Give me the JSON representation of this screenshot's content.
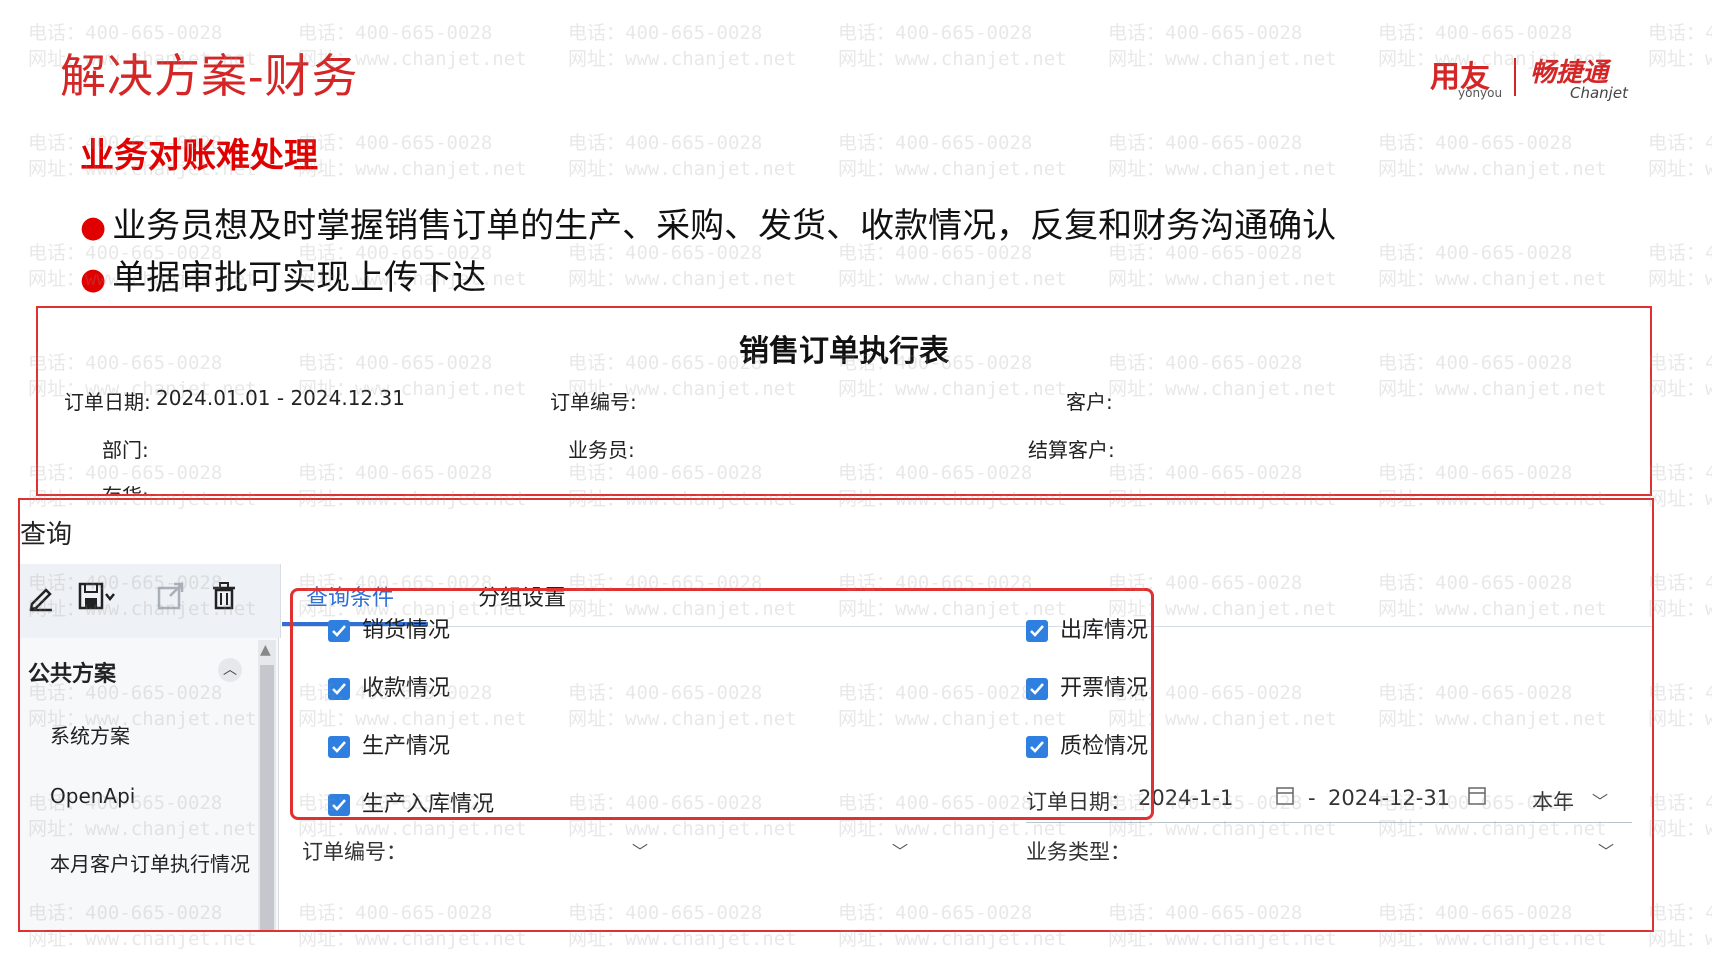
{
  "slide": {
    "title": "解决方案-财务",
    "subheading": "业务对账难处理",
    "bullets": [
      "业务员想及时掌握销售订单的生产、采购、发货、收款情况，反复和财务沟通确认",
      "单据审批可实现上传下达"
    ]
  },
  "brand": {
    "cn_left": "用友",
    "en_left": "yonyou",
    "cn_right": "畅捷通",
    "en_right": "Chanjet"
  },
  "watermark": {
    "phone": "电话：400-665-0028",
    "site": "网址：www.chanjet.net"
  },
  "report": {
    "title": "销售订单执行表",
    "fields": {
      "order_date_label": "订单日期:",
      "order_date_value": "2024.01.01 - 2024.12.31",
      "order_no_label": "订单编号:",
      "customer_label": "客户:",
      "dept_label": "部门:",
      "salesman_label": "业务员:",
      "settle_customer_label": "结算客户:",
      "inventory_label": "存货:"
    }
  },
  "query": {
    "title": "查询",
    "tabs": [
      "查询条件",
      "分组设置"
    ],
    "schemes": {
      "header": "公共方案",
      "items": [
        "系统方案",
        "OpenApi",
        "本月客户订单执行情况"
      ]
    },
    "checkboxes_left": [
      "销货情况",
      "收款情况",
      "生产情况",
      "生产入库情况"
    ],
    "checkboxes_right": [
      "出库情况",
      "开票情况",
      "质检情况"
    ],
    "order_date": {
      "label": "订单日期：",
      "start": "2024-1-1",
      "separator": "-",
      "end": "2024-12-31",
      "period": "本年"
    },
    "order_no_label": "订单编号：",
    "business_type_label": "业务类型："
  },
  "colors": {
    "accent_red": "#d42626",
    "frame_red": "#e03030",
    "checkbox_blue": "#2f7fe0",
    "tab_blue": "#2f6fd6"
  }
}
